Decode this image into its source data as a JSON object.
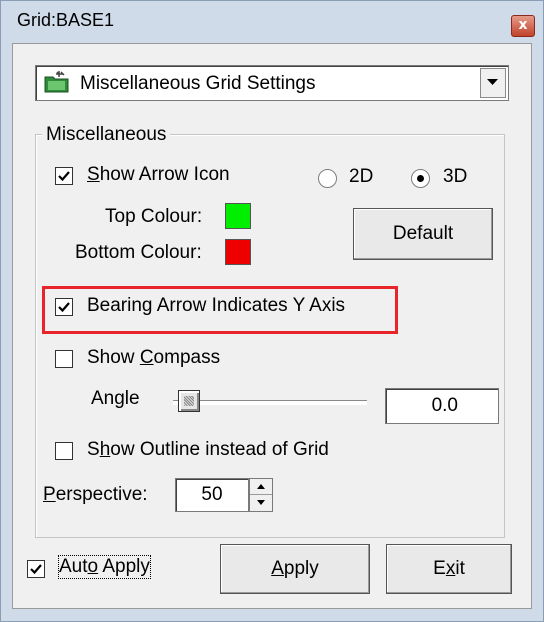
{
  "window": {
    "title": "Grid:BASE1",
    "close_glyph": "x"
  },
  "dropdown": {
    "selected": "Miscellaneous Grid Settings",
    "icon": "settings-folder-icon"
  },
  "group": {
    "legend": "Miscellaneous"
  },
  "show_arrow_icon": {
    "pre": "",
    "accel": "S",
    "post": "how Arrow Icon",
    "checked": true
  },
  "radio_2d": {
    "label": "2D",
    "selected": false
  },
  "radio_3d": {
    "label": "3D",
    "selected": true
  },
  "top_colour": {
    "label": "Top Colour:",
    "color": "#00ee00"
  },
  "bottom_colour": {
    "label": "Bottom Colour:",
    "color": "#ee0000"
  },
  "default_button": {
    "label": "Default"
  },
  "bearing_arrow": {
    "label": "Bearing Arrow Indicates Y Axis",
    "checked": true
  },
  "show_compass": {
    "pre": "Show ",
    "accel": "C",
    "post": "ompass",
    "checked": false
  },
  "angle": {
    "label": "Angle",
    "value": "0.0",
    "slider_fraction": 0
  },
  "show_outline": {
    "pre": "S",
    "accel": "h",
    "post": "ow Outline instead of Grid",
    "checked": false
  },
  "perspective": {
    "pre": "",
    "accel": "P",
    "post": "erspective:",
    "value": "50"
  },
  "auto_apply": {
    "pre": "Aut",
    "accel": "o",
    "post": " Apply",
    "checked": true
  },
  "apply_button": {
    "pre": "",
    "accel": "A",
    "post": "pply"
  },
  "exit_button": {
    "pre": "E",
    "accel": "x",
    "post": "it"
  },
  "colors": {
    "titlebar_bg": "#cfdbe9",
    "highlight_border": "#e8252a"
  }
}
